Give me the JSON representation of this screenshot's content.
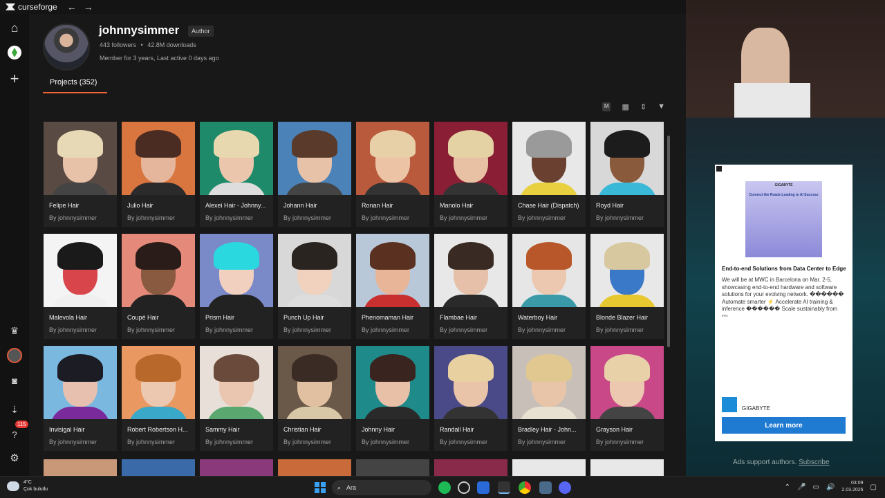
{
  "app": {
    "name": "curseforge"
  },
  "profile": {
    "username": "johnnysimmer",
    "role_badge": "Author",
    "followers": "443 followers",
    "downloads": "42.8M downloads",
    "member": "Member for 3 years,  Last active 0 days ago"
  },
  "tabs": {
    "projects": "Projects (352)"
  },
  "toolbar": {
    "m_label": "M"
  },
  "projects": [
    {
      "name": "Felipe Hair",
      "by": "By johnnysimmer",
      "bg": "#5a4a44",
      "hair": "#e8d9b6",
      "skin": "#e7c2a8",
      "body": "#444"
    },
    {
      "name": "Julio Hair",
      "by": "By johnnysimmer",
      "bg": "#d9753f",
      "hair": "#4a2c22",
      "skin": "#e5b69b",
      "body": "#2b2b2b"
    },
    {
      "name": "Alexei Hair - Johnny...",
      "by": "By johnnysimmer",
      "bg": "#1e8a6a",
      "hair": "#e7d8b0",
      "skin": "#ebc6ad",
      "body": "#ddd"
    },
    {
      "name": "Johann Hair",
      "by": "By johnnysimmer",
      "bg": "#4b82b8",
      "hair": "#5a3a2a",
      "skin": "#e8c2a8",
      "body": "#444"
    },
    {
      "name": "Ronan Hair",
      "by": "By johnnysimmer",
      "bg": "#b85a3b",
      "hair": "#e7cfa8",
      "skin": "#ecc3a5",
      "body": "#333"
    },
    {
      "name": "Manolo Hair",
      "by": "By johnnysimmer",
      "bg": "#8a1e34",
      "hair": "#e4d2a5",
      "skin": "#e8c0a4",
      "body": "#333"
    },
    {
      "name": "Chase Hair (Dispatch)",
      "by": "By johnnysimmer",
      "bg": "#e8e8e8",
      "hair": "#9a9a9a",
      "skin": "#6a4030",
      "body": "#e8d040"
    },
    {
      "name": "Royd Hair",
      "by": "By johnnysimmer",
      "bg": "#d8d8d8",
      "hair": "#1c1c1c",
      "skin": "#8a5a3c",
      "body": "#3ab8d8"
    },
    {
      "name": "Malevola Hair",
      "by": "By johnnysimmer",
      "bg": "#f4f4f4",
      "hair": "#1a1a1a",
      "skin": "#d8454a",
      "body": "#f0f0f0"
    },
    {
      "name": "Coupé Hair",
      "by": "By johnnysimmer",
      "bg": "#e58a7a",
      "hair": "#2a1c18",
      "skin": "#8a5a40",
      "body": "#222"
    },
    {
      "name": "Prism Hair",
      "by": "By johnnysimmer",
      "bg": "#7a8ac8",
      "hair": "#2ad8e0",
      "skin": "#f2d0c0",
      "body": "#222"
    },
    {
      "name": "Punch Up Hair",
      "by": "By johnnysimmer",
      "bg": "#d8d8d8",
      "hair": "#2a2420",
      "skin": "#f0d2bf",
      "body": "#ddd"
    },
    {
      "name": "Phenomaman Hair",
      "by": "By johnnysimmer",
      "bg": "#b8c8d8",
      "hair": "#5a3020",
      "skin": "#e8b598",
      "body": "#c83030"
    },
    {
      "name": "Flambae Hair",
      "by": "By johnnysimmer",
      "bg": "#e8e8e8",
      "hair": "#3a2a24",
      "skin": "#e6c0a8",
      "body": "#2a2a2a"
    },
    {
      "name": "Waterboy Hair",
      "by": "By johnnysimmer",
      "bg": "#e6e6e6",
      "hair": "#b8582a",
      "skin": "#ecc8b0",
      "body": "#3a9aa8"
    },
    {
      "name": "Blonde Blazer Hair",
      "by": "By johnnysimmer",
      "bg": "#e8e8e8",
      "hair": "#d8c8a0",
      "skin": "#3a78c8",
      "body": "#e8c830"
    },
    {
      "name": "Invisigal Hair",
      "by": "By johnnysimmer",
      "bg": "#7ab8e0",
      "hair": "#1c1c24",
      "skin": "#e8c0b0",
      "body": "#7a2a9a"
    },
    {
      "name": "Robert Robertson H...",
      "by": "By johnnysimmer",
      "bg": "#e89860",
      "hair": "#b8682a",
      "skin": "#ecc8b0",
      "body": "#3aa8c8"
    },
    {
      "name": "Sammy Hair",
      "by": "By johnnysimmer",
      "bg": "#e8e0d8",
      "hair": "#6a4a3a",
      "skin": "#eac6b0",
      "body": "#5aa870"
    },
    {
      "name": "Christian Hair",
      "by": "By johnnysimmer",
      "bg": "#6a5848",
      "hair": "#3a2c24",
      "skin": "#e0c0a0",
      "body": "#d8c8a8"
    },
    {
      "name": "Johnny Hair",
      "by": "By johnnysimmer",
      "bg": "#1e8a8a",
      "hair": "#3a2420",
      "skin": "#e8c0a8",
      "body": "#2a2a2a"
    },
    {
      "name": "Randall Hair",
      "by": "By johnnysimmer",
      "bg": "#4a4a88",
      "hair": "#e8d0a0",
      "skin": "#eac4a8",
      "body": "#333"
    },
    {
      "name": "Bradley Hair - John...",
      "by": "By johnnysimmer",
      "bg": "#c8c0b8",
      "hair": "#e0c890",
      "skin": "#e8c4a8",
      "body": "#e8e0d0"
    },
    {
      "name": "Grayson Hair",
      "by": "By johnnysimmer",
      "bg": "#c84888",
      "hair": "#e8d0a8",
      "skin": "#ecc8b0",
      "body": "#444"
    }
  ],
  "partial_colors": [
    "#c89878",
    "#3a6aa8",
    "#8a3a7a",
    "#c86a3a",
    "#444",
    "#8a2a4a",
    "#e8e8e8",
    "#e8e8e8"
  ],
  "ad": {
    "image_line1": "GIGABYTE",
    "image_line2": "Connect the Roads Leading to AI Success",
    "title": "End-to-end Solutions from Data Center to Edge",
    "body": "We will be at MWC in Barcelona on Mar. 2-5, showcasing end-to-end hardware and software solutions for your evolving network. ������ Automate smarter ⚡ Accelerate AI training & inference ������ Scale sustainably from co...",
    "advertiser": "GIGABYTE",
    "cta": "Learn more"
  },
  "ads_footer": {
    "text": "Ads support authors. ",
    "link": "Subscribe"
  },
  "taskbar": {
    "weather_temp": "4°C",
    "weather_desc": "Çok bulutlu",
    "search_placeholder": "Ara",
    "time": "03:09",
    "date": "2.03.2026",
    "notif_badge": "115"
  }
}
